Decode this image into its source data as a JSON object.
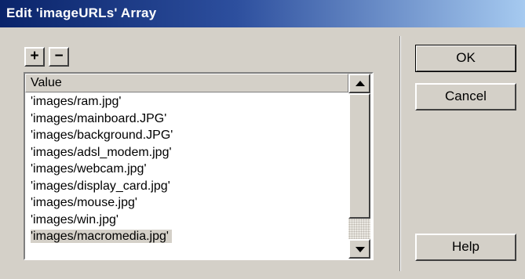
{
  "window": {
    "title": "Edit 'imageURLs' Array"
  },
  "toolbar": {
    "add_label": "+",
    "remove_label": "−"
  },
  "list": {
    "header": "Value",
    "items": [
      "'images/ram.jpg'",
      "'images/mainboard.JPG'",
      "'images/background.JPG'",
      "'images/adsl_modem.jpg'",
      "'images/webcam.jpg'",
      "'images/display_card.jpg'",
      "'images/mouse.jpg'",
      "'images/win.jpg'",
      "'images/macromedia.jpg'"
    ],
    "selected_index": 8
  },
  "buttons": {
    "ok": "OK",
    "cancel": "Cancel",
    "help": "Help"
  }
}
